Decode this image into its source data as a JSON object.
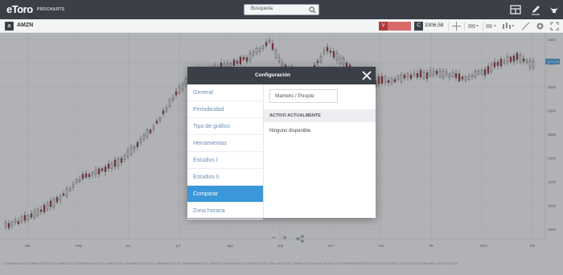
{
  "topbar": {
    "logo": "eToro",
    "logo_sub": "PROCHARTS",
    "search_placeholder": "Busqueda",
    "icons": [
      "layout-icon",
      "pencil-icon",
      "bull-icon"
    ]
  },
  "toolbar": {
    "symbol_badge": "a",
    "symbol": "AMZN",
    "sell_badge": "V",
    "buy_badge": "C",
    "buy_price": "3306.58"
  },
  "chart": {
    "x_labels": [
      "abr",
      "may",
      "jun",
      "jul",
      "ago",
      "sep",
      "oct",
      "nov",
      "dic",
      "2021",
      "feb"
    ],
    "y_labels": [
      "3400",
      "3200",
      "3000",
      "2800",
      "2600",
      "2400",
      "2200",
      "2000",
      "1800"
    ],
    "price_tag": "3270.96",
    "colors": {
      "up": "#ffffff",
      "down": "#b7232a",
      "grid": "#e8eaed",
      "accent": "#3a97d8"
    }
  },
  "zoom": {
    "minus": "−",
    "plus": "+",
    "share": "share-icon"
  },
  "disclaimer": "LA INFORMACIÓN SOBRE PRECIOS DE MERCADO CONTENIDA EN ESTE GRÁFICO ES ÚNICAMENTE A TÍTULO INFORMATIVO. EL RENDIMIENTO DEL GRÁFICO SE BASA EN LOS RESULTADOS SIMULADOS DE COMPRA-VENTA EN EL PASADO Y NO REPRESENTA RESULTADOS FUTUROS. LOS DATOS PUEDEN INCLUIR RETRASOS.",
  "modal": {
    "title": "Configuración",
    "nav": [
      "General",
      "Periodicidad",
      "Tipo de gráfico",
      "Herramientas",
      "Estudios I",
      "Estudios II",
      "Comparar",
      "Zona horaria"
    ],
    "active_index": 6,
    "compare_value": "Markets / People",
    "section_title": "ACTIVO ACTUALMENTE",
    "section_text": "Ninguno disponible"
  }
}
